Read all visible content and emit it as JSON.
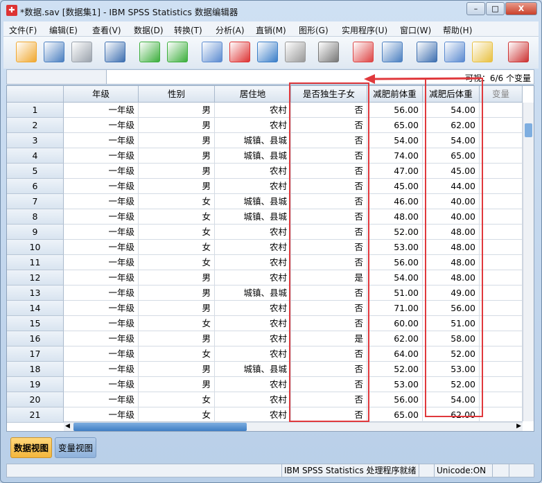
{
  "window": {
    "title": "*数据.sav [数据集1] - IBM SPSS Statistics 数据编辑器",
    "minimize": "–",
    "maximize": "□",
    "close": "X"
  },
  "menu": [
    "文件(F)",
    "编辑(E)",
    "查看(V)",
    "数据(D)",
    "转换(T)",
    "分析(A)",
    "直销(M)",
    "图形(G)",
    "实用程序(U)",
    "窗口(W)",
    "帮助(H)"
  ],
  "toolbar": [
    {
      "icon": "open-folder-icon",
      "color": "#f0a830"
    },
    {
      "icon": "save-icon",
      "color": "#4a7fc0"
    },
    {
      "icon": "print-icon",
      "color": "#9aa2ac"
    },
    {
      "icon": "recall-dialog-icon",
      "color": "#3d6fb0"
    },
    {
      "icon": "undo-icon",
      "color": "#3cae3c"
    },
    {
      "icon": "redo-icon",
      "color": "#3cae3c"
    },
    {
      "icon": "goto-case-icon",
      "color": "#5a8ad0"
    },
    {
      "icon": "goto-variable-icon",
      "color": "#d33"
    },
    {
      "icon": "variables-icon",
      "color": "#3a7ec8"
    },
    {
      "icon": "run-descriptives-icon",
      "color": "#999"
    },
    {
      "icon": "find-icon",
      "color": "#777"
    },
    {
      "icon": "insert-cases-icon",
      "color": "#d44"
    },
    {
      "icon": "insert-variable-icon",
      "color": "#4a7fc0"
    },
    {
      "icon": "split-file-icon",
      "color": "#3d6fb0"
    },
    {
      "icon": "weight-cases-icon",
      "color": "#5a8ad0"
    },
    {
      "icon": "select-cases-icon",
      "color": "#e8c040"
    },
    {
      "icon": "value-labels-icon",
      "color": "#c33"
    }
  ],
  "cellbar": {
    "visible": "可视：6/6 个变量"
  },
  "columns": [
    "年级",
    "性别",
    "居住地",
    "是否独生子女",
    "减肥前体重",
    "减肥后体重",
    "变量"
  ],
  "rows": [
    [
      "1",
      "一年级",
      "男",
      "农村",
      "否",
      "56.00",
      "54.00"
    ],
    [
      "2",
      "一年级",
      "男",
      "农村",
      "否",
      "65.00",
      "62.00"
    ],
    [
      "3",
      "一年级",
      "男",
      "城镇、县城",
      "否",
      "54.00",
      "54.00"
    ],
    [
      "4",
      "一年级",
      "男",
      "城镇、县城",
      "否",
      "74.00",
      "65.00"
    ],
    [
      "5",
      "一年级",
      "男",
      "农村",
      "否",
      "47.00",
      "45.00"
    ],
    [
      "6",
      "一年级",
      "男",
      "农村",
      "否",
      "45.00",
      "44.00"
    ],
    [
      "7",
      "一年级",
      "女",
      "城镇、县城",
      "否",
      "46.00",
      "40.00"
    ],
    [
      "8",
      "一年级",
      "女",
      "城镇、县城",
      "否",
      "48.00",
      "40.00"
    ],
    [
      "9",
      "一年级",
      "女",
      "农村",
      "否",
      "52.00",
      "48.00"
    ],
    [
      "10",
      "一年级",
      "女",
      "农村",
      "否",
      "53.00",
      "48.00"
    ],
    [
      "11",
      "一年级",
      "女",
      "农村",
      "否",
      "56.00",
      "48.00"
    ],
    [
      "12",
      "一年级",
      "男",
      "农村",
      "是",
      "54.00",
      "48.00"
    ],
    [
      "13",
      "一年级",
      "男",
      "城镇、县城",
      "否",
      "51.00",
      "49.00"
    ],
    [
      "14",
      "一年级",
      "男",
      "农村",
      "否",
      "71.00",
      "56.00"
    ],
    [
      "15",
      "一年级",
      "女",
      "农村",
      "否",
      "60.00",
      "51.00"
    ],
    [
      "16",
      "一年级",
      "男",
      "农村",
      "是",
      "62.00",
      "58.00"
    ],
    [
      "17",
      "一年级",
      "女",
      "农村",
      "否",
      "64.00",
      "52.00"
    ],
    [
      "18",
      "一年级",
      "男",
      "城镇、县城",
      "否",
      "52.00",
      "53.00"
    ],
    [
      "19",
      "一年级",
      "男",
      "农村",
      "否",
      "53.00",
      "52.00"
    ],
    [
      "20",
      "一年级",
      "女",
      "农村",
      "否",
      "56.00",
      "54.00"
    ],
    [
      "21",
      "一年级",
      "女",
      "农村",
      "否",
      "65.00",
      "62.00"
    ]
  ],
  "tabs": {
    "data_view": "数据视图",
    "variable_view": "变量视图"
  },
  "status": {
    "processor": "IBM SPSS Statistics 处理程序就绪",
    "unicode": "Unicode:ON"
  },
  "annotation_color": "#e0383c"
}
